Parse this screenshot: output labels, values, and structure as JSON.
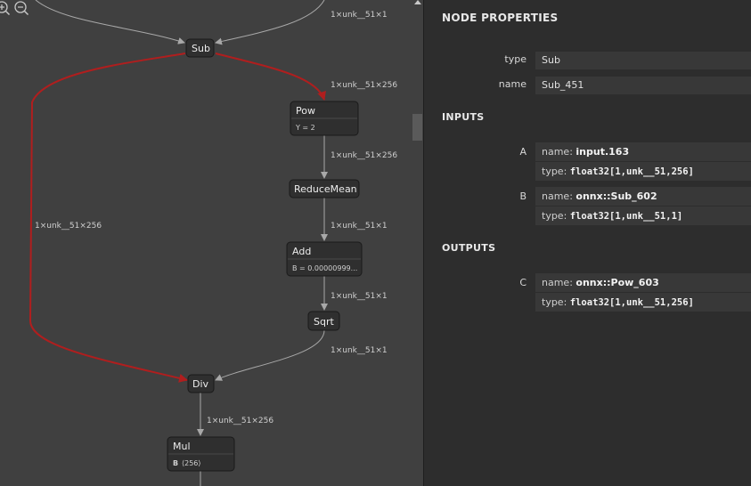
{
  "graph": {
    "zoom_in_icon": "zoom-in-icon",
    "zoom_out_icon": "zoom-out-icon",
    "edge_labels": {
      "top": "1×unk__51×1",
      "sub_pow": "1×unk__51×256",
      "pow_reducemean": "1×unk__51×256",
      "reducemean_add": "1×unk__51×1",
      "add_sqrt": "1×unk__51×1",
      "sqrt_div": "1×unk__51×1",
      "sub_div": "1×unk__51×256",
      "div_mul": "1×unk__51×256"
    },
    "nodes": {
      "sub": {
        "title": "Sub"
      },
      "pow": {
        "title": "Pow",
        "attr": "Y = 2"
      },
      "reducemean": {
        "title": "ReduceMean"
      },
      "add": {
        "title": "Add",
        "attr": "B = 0.00000999..."
      },
      "sqrt": {
        "title": "Sqrt"
      },
      "div": {
        "title": "Div"
      },
      "mul": {
        "title": "Mul",
        "attr_key": "B",
        "attr_val": "⟨256⟩"
      }
    },
    "highlight_color": "#b01e1e"
  },
  "properties": {
    "title": "NODE PROPERTIES",
    "type_label": "type",
    "type_value": "Sub",
    "name_label": "name",
    "name_value": "Sub_451",
    "inputs_title": "INPUTS",
    "inputs": [
      {
        "label": "A",
        "name_key": "name:",
        "name": "input.163",
        "type_key": "type:",
        "type": "float32[1,unk__51,256]"
      },
      {
        "label": "B",
        "name_key": "name:",
        "name": "onnx::Sub_602",
        "type_key": "type:",
        "type": "float32[1,unk__51,1]"
      }
    ],
    "outputs_title": "OUTPUTS",
    "outputs": [
      {
        "label": "C",
        "name_key": "name:",
        "name": "onnx::Pow_603",
        "type_key": "type:",
        "type": "float32[1,unk__51,256]"
      }
    ]
  }
}
